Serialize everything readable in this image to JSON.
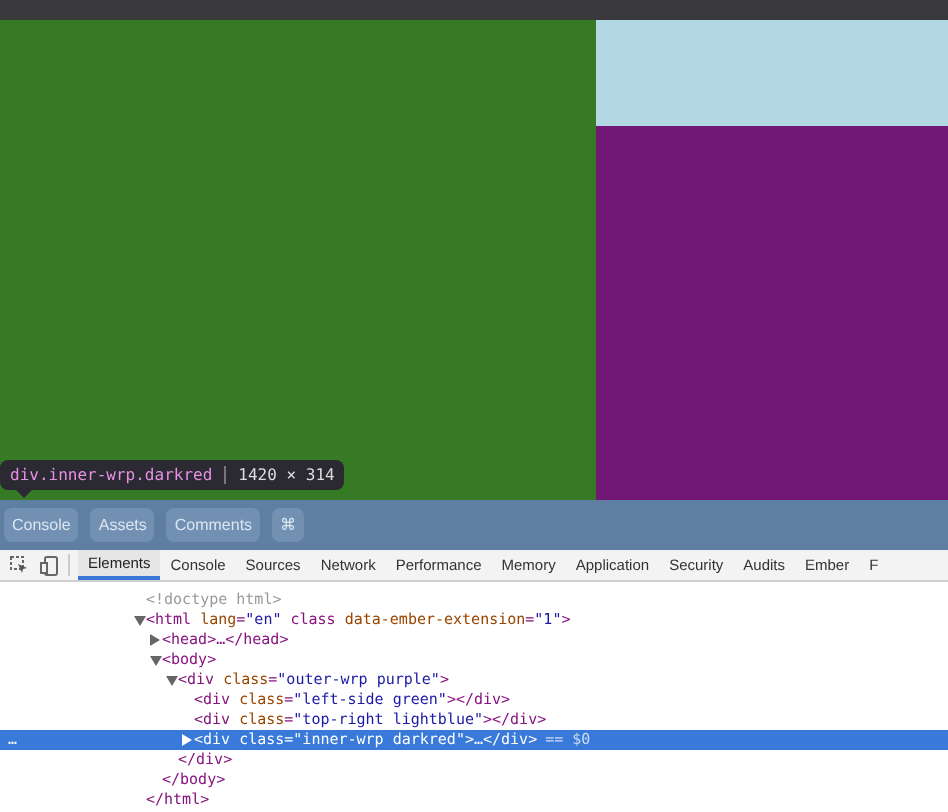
{
  "page_preview": {
    "tooltip": {
      "selector": "div.inner-wrp.darkred",
      "size": "1420 × 314"
    }
  },
  "drawer_tabs": [
    {
      "label": "Console",
      "selected": false
    },
    {
      "label": "Assets",
      "selected": false
    },
    {
      "label": "Comments",
      "selected": false
    },
    {
      "label": "⌘",
      "selected": false
    }
  ],
  "panel_tabs": [
    {
      "label": "Elements",
      "selected": true
    },
    {
      "label": "Console",
      "selected": false
    },
    {
      "label": "Sources",
      "selected": false
    },
    {
      "label": "Network",
      "selected": false
    },
    {
      "label": "Performance",
      "selected": false
    },
    {
      "label": "Memory",
      "selected": false
    },
    {
      "label": "Application",
      "selected": false
    },
    {
      "label": "Security",
      "selected": false
    },
    {
      "label": "Audits",
      "selected": false
    },
    {
      "label": "Ember",
      "selected": false
    },
    {
      "label": "F",
      "selected": false
    }
  ],
  "dom_tree": [
    {
      "kind": "leaf",
      "text": "<!doctype html>",
      "selected": false
    },
    {
      "kind": "element",
      "text": "<html lang=\"en\" class data-ember-extension=\"1\">",
      "expanded": true,
      "selected": false,
      "close": "</html>",
      "children": [
        {
          "kind": "element",
          "text": "<head>…</head>",
          "expanded": false,
          "selected": false
        },
        {
          "kind": "element",
          "text": "<body>",
          "expanded": true,
          "selected": false,
          "close": "</body>",
          "children": [
            {
              "kind": "element",
              "text": "<div class=\"outer-wrp purple\">",
              "expanded": true,
              "selected": false,
              "close": "</div>",
              "children": [
                {
                  "kind": "leaf",
                  "text": "<div class=\"left-side green\"></div>",
                  "selected": false
                },
                {
                  "kind": "leaf",
                  "text": "<div class=\"top-right lightblue\"></div>",
                  "selected": false
                },
                {
                  "kind": "element",
                  "text": "<div class=\"inner-wrp darkred\">…</div>",
                  "expanded": false,
                  "selected": true,
                  "marker": "== $0",
                  "gutter": "…"
                }
              ]
            }
          ]
        }
      ]
    }
  ]
}
